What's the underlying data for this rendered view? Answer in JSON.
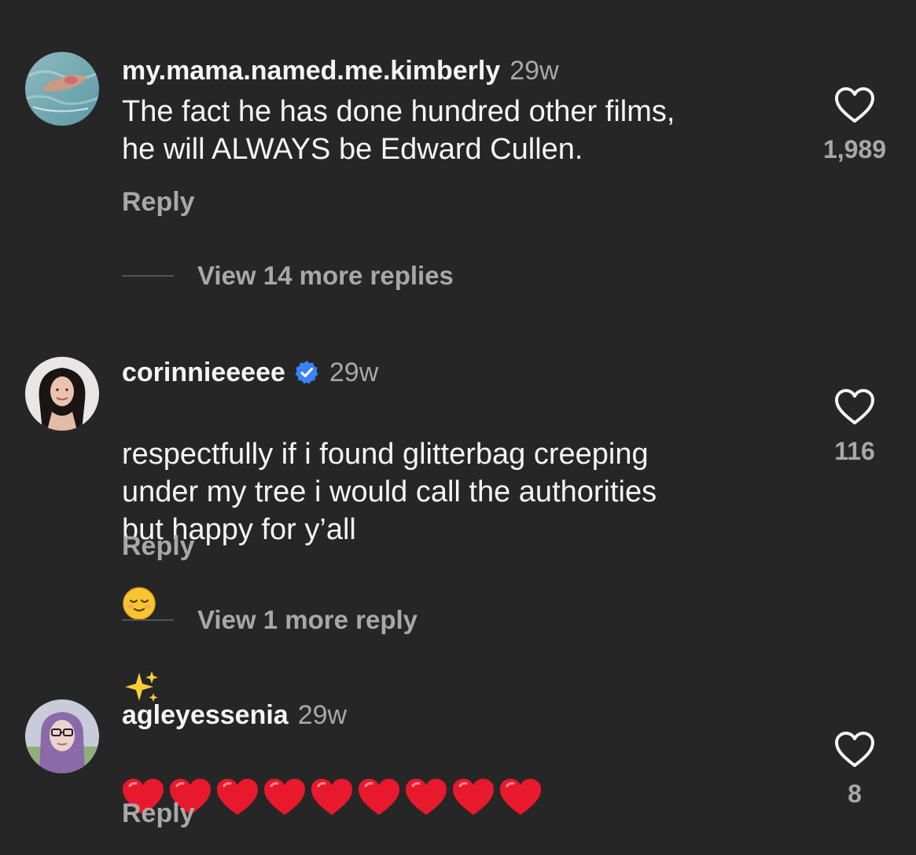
{
  "colors": {
    "background": "#262626",
    "primary_text": "#f5f5f5",
    "secondary_text": "#a8a8a8",
    "verified_blue": "#3b82f6",
    "heart_red": "#e8192c"
  },
  "comments": [
    {
      "username": "my.mama.named.me.kimberly",
      "time": "29w",
      "text": "The fact he has done hundred other films,\nhe will ALWAYS be Edward Cullen.",
      "likes": "1,989",
      "reply_label": "Reply",
      "view_more": "View 14 more replies",
      "verified": false
    },
    {
      "username": "corinnieeeee",
      "time": "29w",
      "text": "respectfully if i found glitterbag creeping\nunder my tree i would call the authorities\nbut happy for y’all",
      "emoji": [
        "relieved-face-emoji",
        "sparkles-emoji"
      ],
      "likes": "116",
      "reply_label": "Reply",
      "view_more": "View 1 more reply",
      "verified": true
    },
    {
      "username": "agleyessenia",
      "time": "29w",
      "heart_count": 9,
      "likes": "8",
      "reply_label": "Reply",
      "verified": false
    }
  ]
}
